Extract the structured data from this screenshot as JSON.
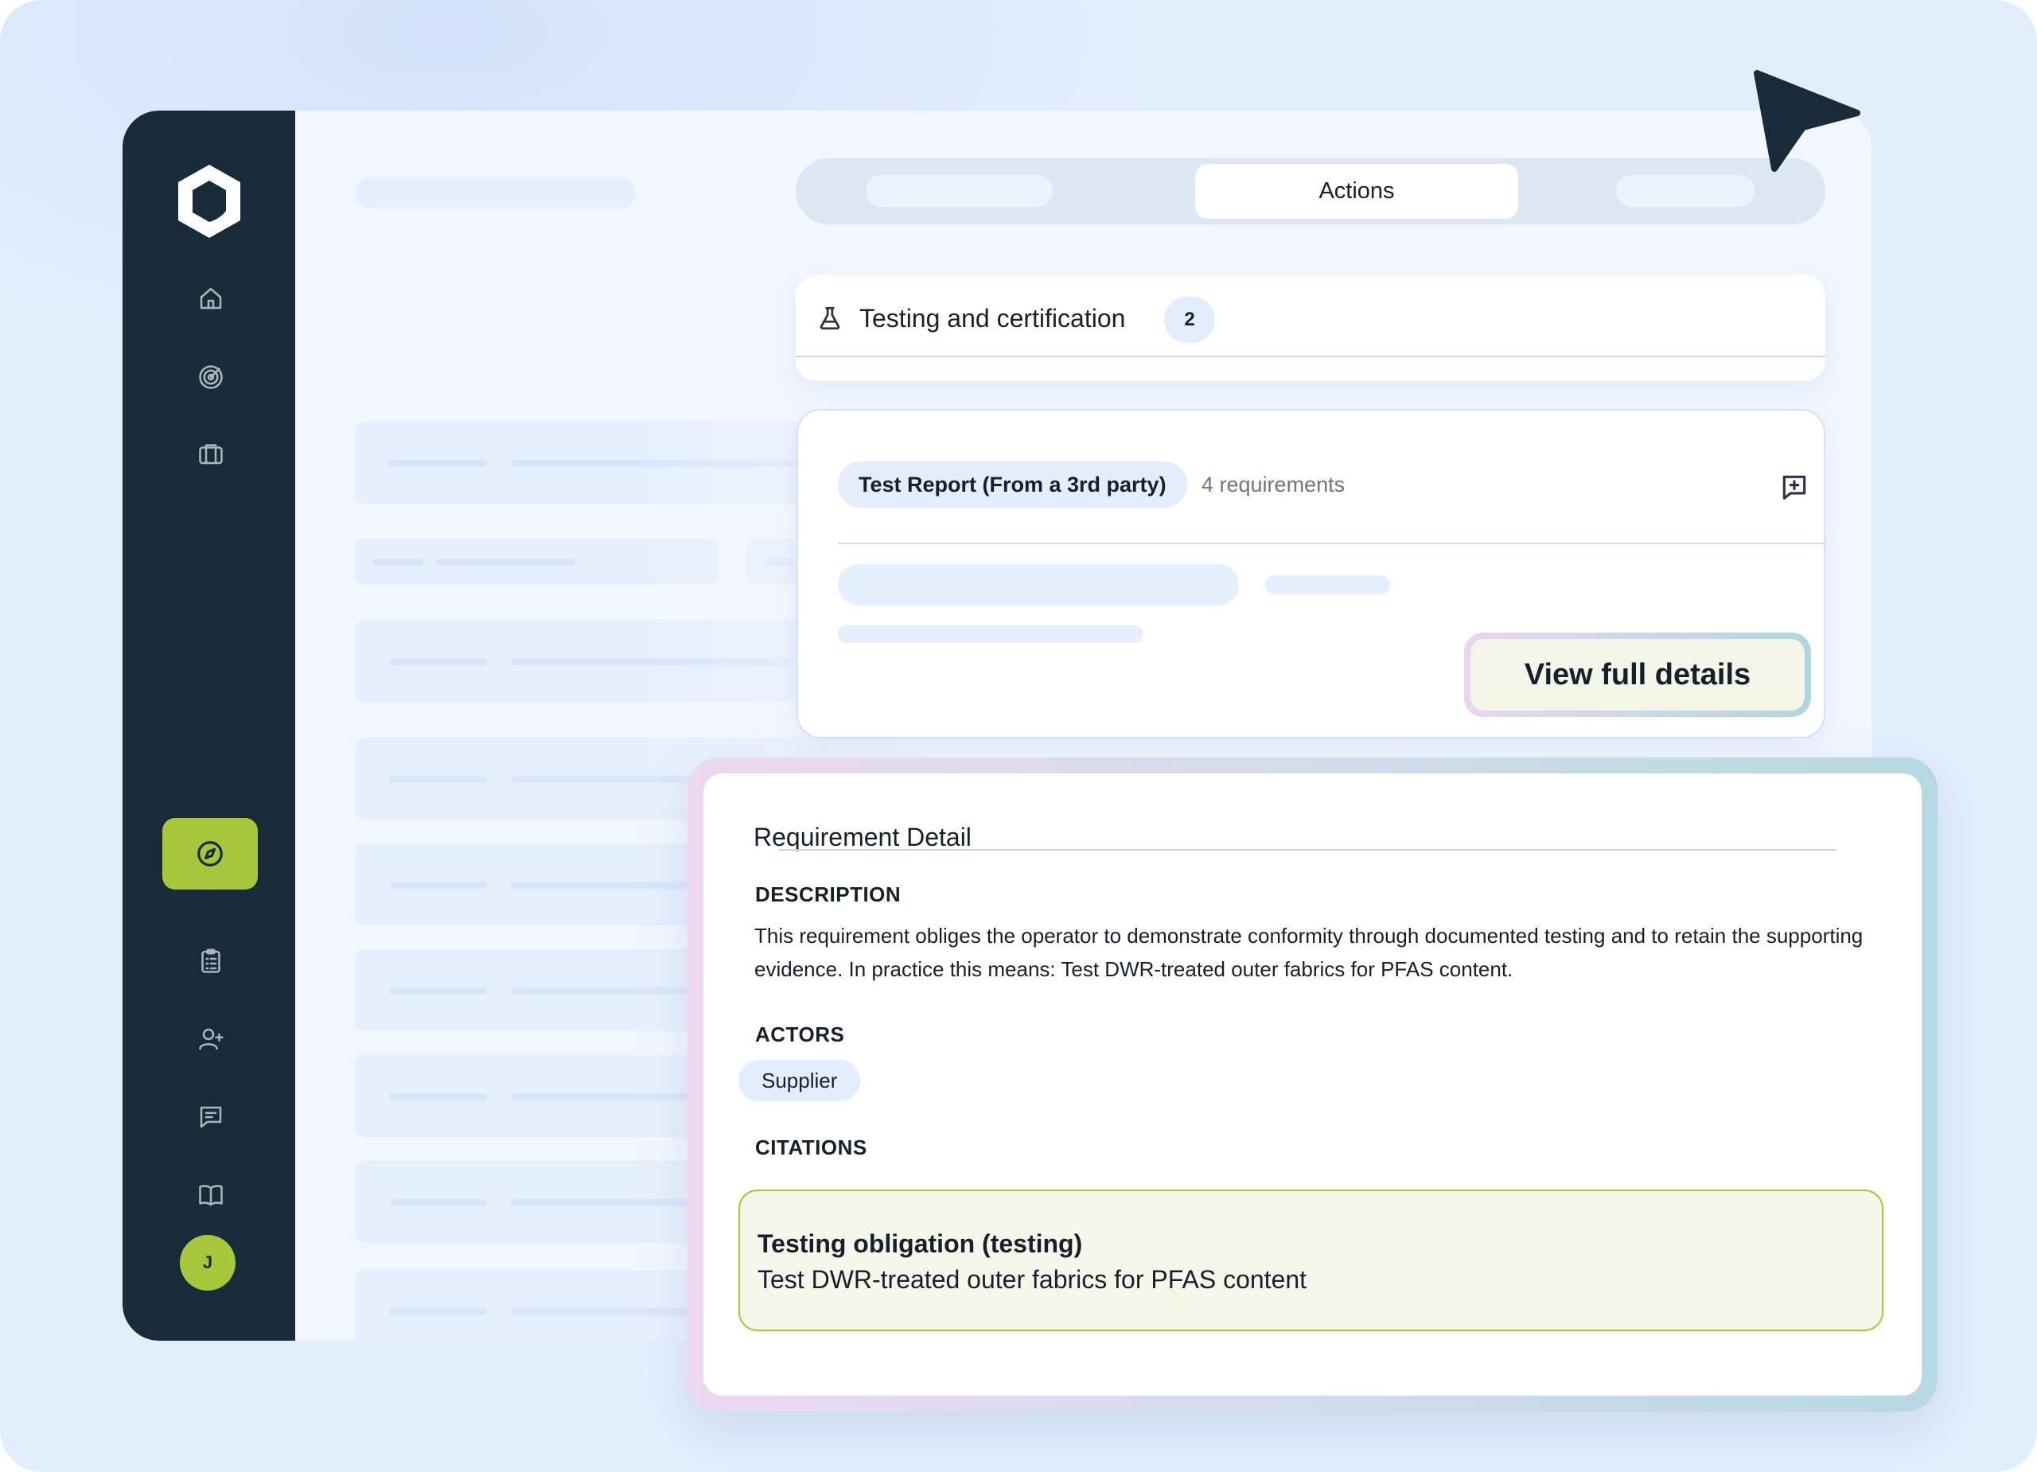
{
  "colors": {
    "sidebar": "#172b39",
    "accent_green": "#a7c63b",
    "page_background": "#e3eefd",
    "pill_blue": "#e3edfc",
    "citation_background": "#f5f7ea"
  },
  "sidebar": {
    "logo_icon": "hexagon-logo-icon",
    "nav_top": [
      {
        "icon": "home-icon"
      },
      {
        "icon": "radar-icon"
      },
      {
        "icon": "briefcase-icon"
      }
    ],
    "nav_active": {
      "icon": "compass-icon"
    },
    "nav_bottom": [
      {
        "icon": "clipboard-list-icon"
      },
      {
        "icon": "user-plus-icon"
      },
      {
        "icon": "message-lines-icon"
      },
      {
        "icon": "book-open-icon"
      }
    ],
    "avatar_initial": "J"
  },
  "tabs": {
    "active_label": "Actions"
  },
  "section": {
    "icon": "flask-icon",
    "title": "Testing and certification",
    "count": "2"
  },
  "requirement_card": {
    "pill_label": "Test Report (From a 3rd party)",
    "requirements_count": "4 requirements",
    "comment_icon": "message-plus-icon",
    "button_label": "View full details"
  },
  "detail_panel": {
    "title": "Requirement Detail",
    "description_label": "DESCRIPTION",
    "description_text": "This requirement obliges the operator to demonstrate conformity through documented testing and to retain the supporting evidence. In practice this means: Test DWR-treated outer fabrics for PFAS content.",
    "actors_label": "ACTORS",
    "actors": [
      "Supplier"
    ],
    "citations_label": "CITATIONS",
    "citation": {
      "title": "Testing obligation (testing)",
      "text": "Test DWR-treated outer fabrics for PFAS content"
    }
  },
  "cursor_icon": "pointer-arrow-icon"
}
